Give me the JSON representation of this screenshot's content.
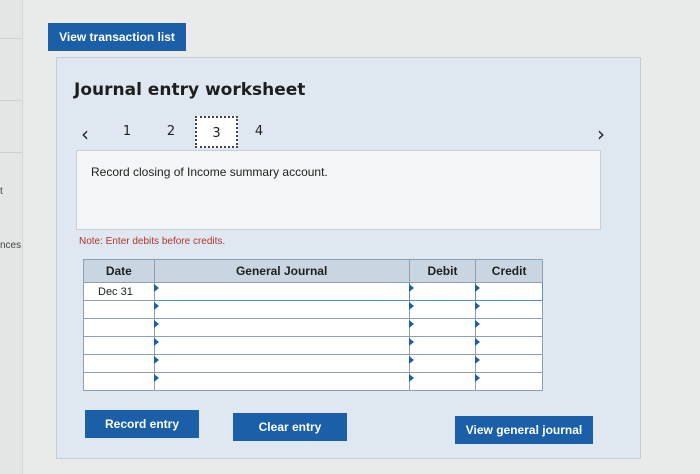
{
  "header": {
    "view_transaction_list": "View transaction list"
  },
  "left_strip": {
    "fragment_t": "t",
    "fragment_nces": "nces"
  },
  "worksheet": {
    "title": "Journal entry worksheet",
    "pager": {
      "prev_icon": "chevron-left-icon",
      "next_icon": "chevron-right-icon",
      "pages": [
        "1",
        "2",
        "3",
        "4"
      ],
      "active_page": "3"
    },
    "instruction": "Record closing of Income summary account.",
    "note": "Note: Enter debits before credits.",
    "table": {
      "headers": [
        "Date",
        "General Journal",
        "Debit",
        "Credit"
      ],
      "rows": [
        {
          "date": "Dec 31"
        },
        {
          "date": ""
        },
        {
          "date": ""
        },
        {
          "date": ""
        },
        {
          "date": ""
        },
        {
          "date": ""
        }
      ]
    },
    "buttons": {
      "record_entry": "Record entry",
      "clear_entry": "Clear entry",
      "view_general_journal": "View general journal"
    }
  },
  "colors": {
    "button_blue": "#1a5fa8",
    "panel_bg": "#dfe8f0",
    "note_red": "#b0352a"
  }
}
